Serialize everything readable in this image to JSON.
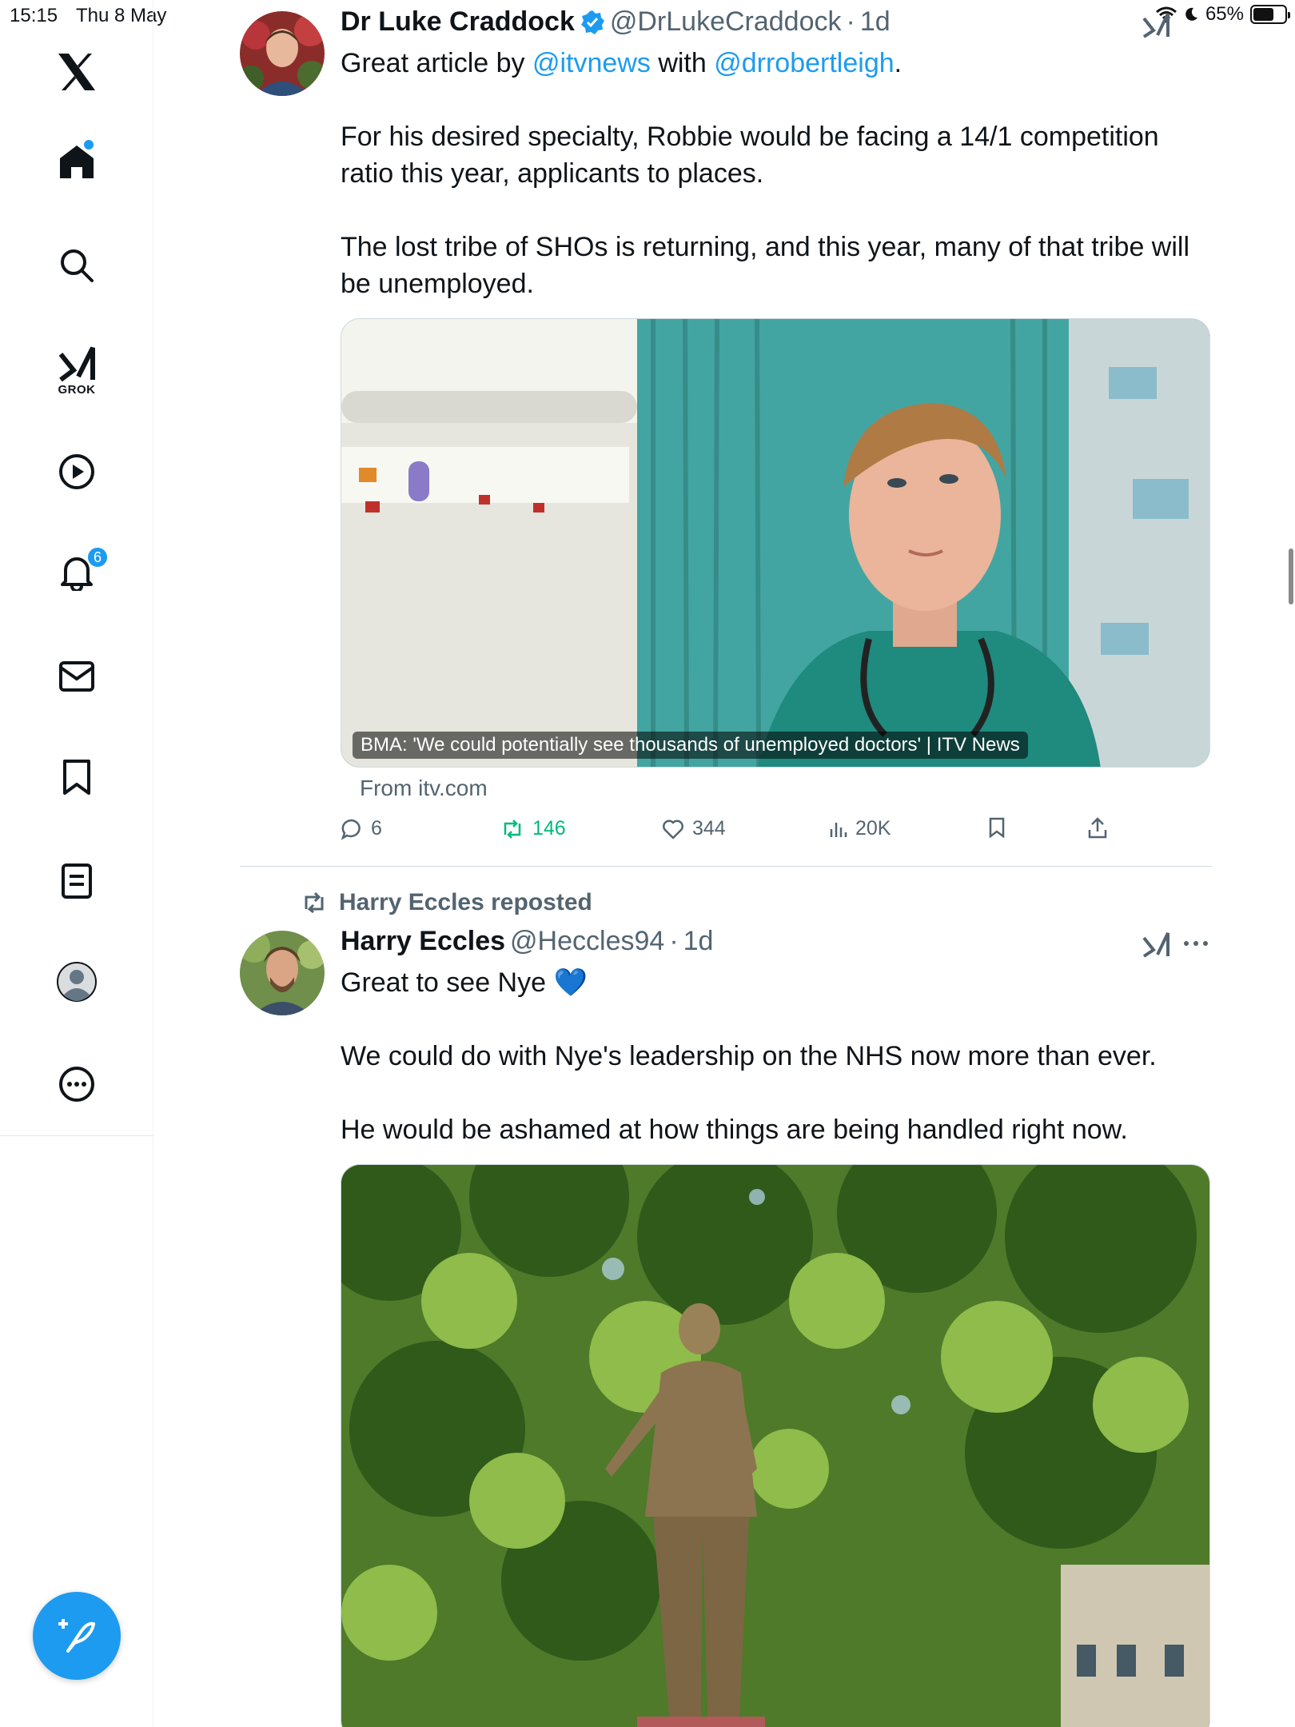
{
  "status_bar": {
    "time": "15:15",
    "date": "Thu 8 May",
    "battery": "65%",
    "battery_level": 0.65
  },
  "sidebar": {
    "items": [
      {
        "name": "home",
        "label": "Home"
      },
      {
        "name": "explore",
        "label": "Search"
      },
      {
        "name": "grok",
        "label": "GROK"
      },
      {
        "name": "video",
        "label": "Video"
      },
      {
        "name": "notifications",
        "label": "Notifications",
        "badge": "6"
      },
      {
        "name": "messages",
        "label": "Messages"
      },
      {
        "name": "bookmarks",
        "label": "Bookmarks"
      },
      {
        "name": "lists",
        "label": "Lists"
      },
      {
        "name": "profile",
        "label": "Profile"
      },
      {
        "name": "more",
        "label": "More"
      }
    ]
  },
  "tweets": [
    {
      "display_name": "Dr Luke Craddock",
      "handle": "@DrLukeCraddock",
      "time": "1d",
      "text": {
        "p1_prefix": "Great article by ",
        "mention1": "@itvnews",
        "p1_mid": " with ",
        "mention2": "@drrobertleigh",
        "p1_suffix": ".",
        "p2": "For his desired specialty, Robbie would be facing a 14/1 competition ratio this year, applicants to places.",
        "p3": "The lost tribe of SHOs is returning, and this year, many of that tribe will be unemployed."
      },
      "card": {
        "caption": "BMA: 'We could potentially see thousands of unemployed doctors' | ITV News",
        "source": "From itv.com"
      },
      "stats": {
        "replies": "6",
        "reposts": "146",
        "likes": "344",
        "views": "20K"
      }
    },
    {
      "repost_by": "Harry Eccles reposted",
      "display_name": "Harry Eccles",
      "handle": "@Heccles94",
      "time": "1d",
      "text": {
        "p1": "Great to see Nye 💙",
        "p2": "We could do with Nye's leadership on the NHS now more than ever.",
        "p3": "He would be ashamed at how things are being handled right now."
      }
    }
  ],
  "colors": {
    "accent": "#1d9bf0",
    "repost_green": "#00ba7c",
    "muted": "#536471"
  }
}
